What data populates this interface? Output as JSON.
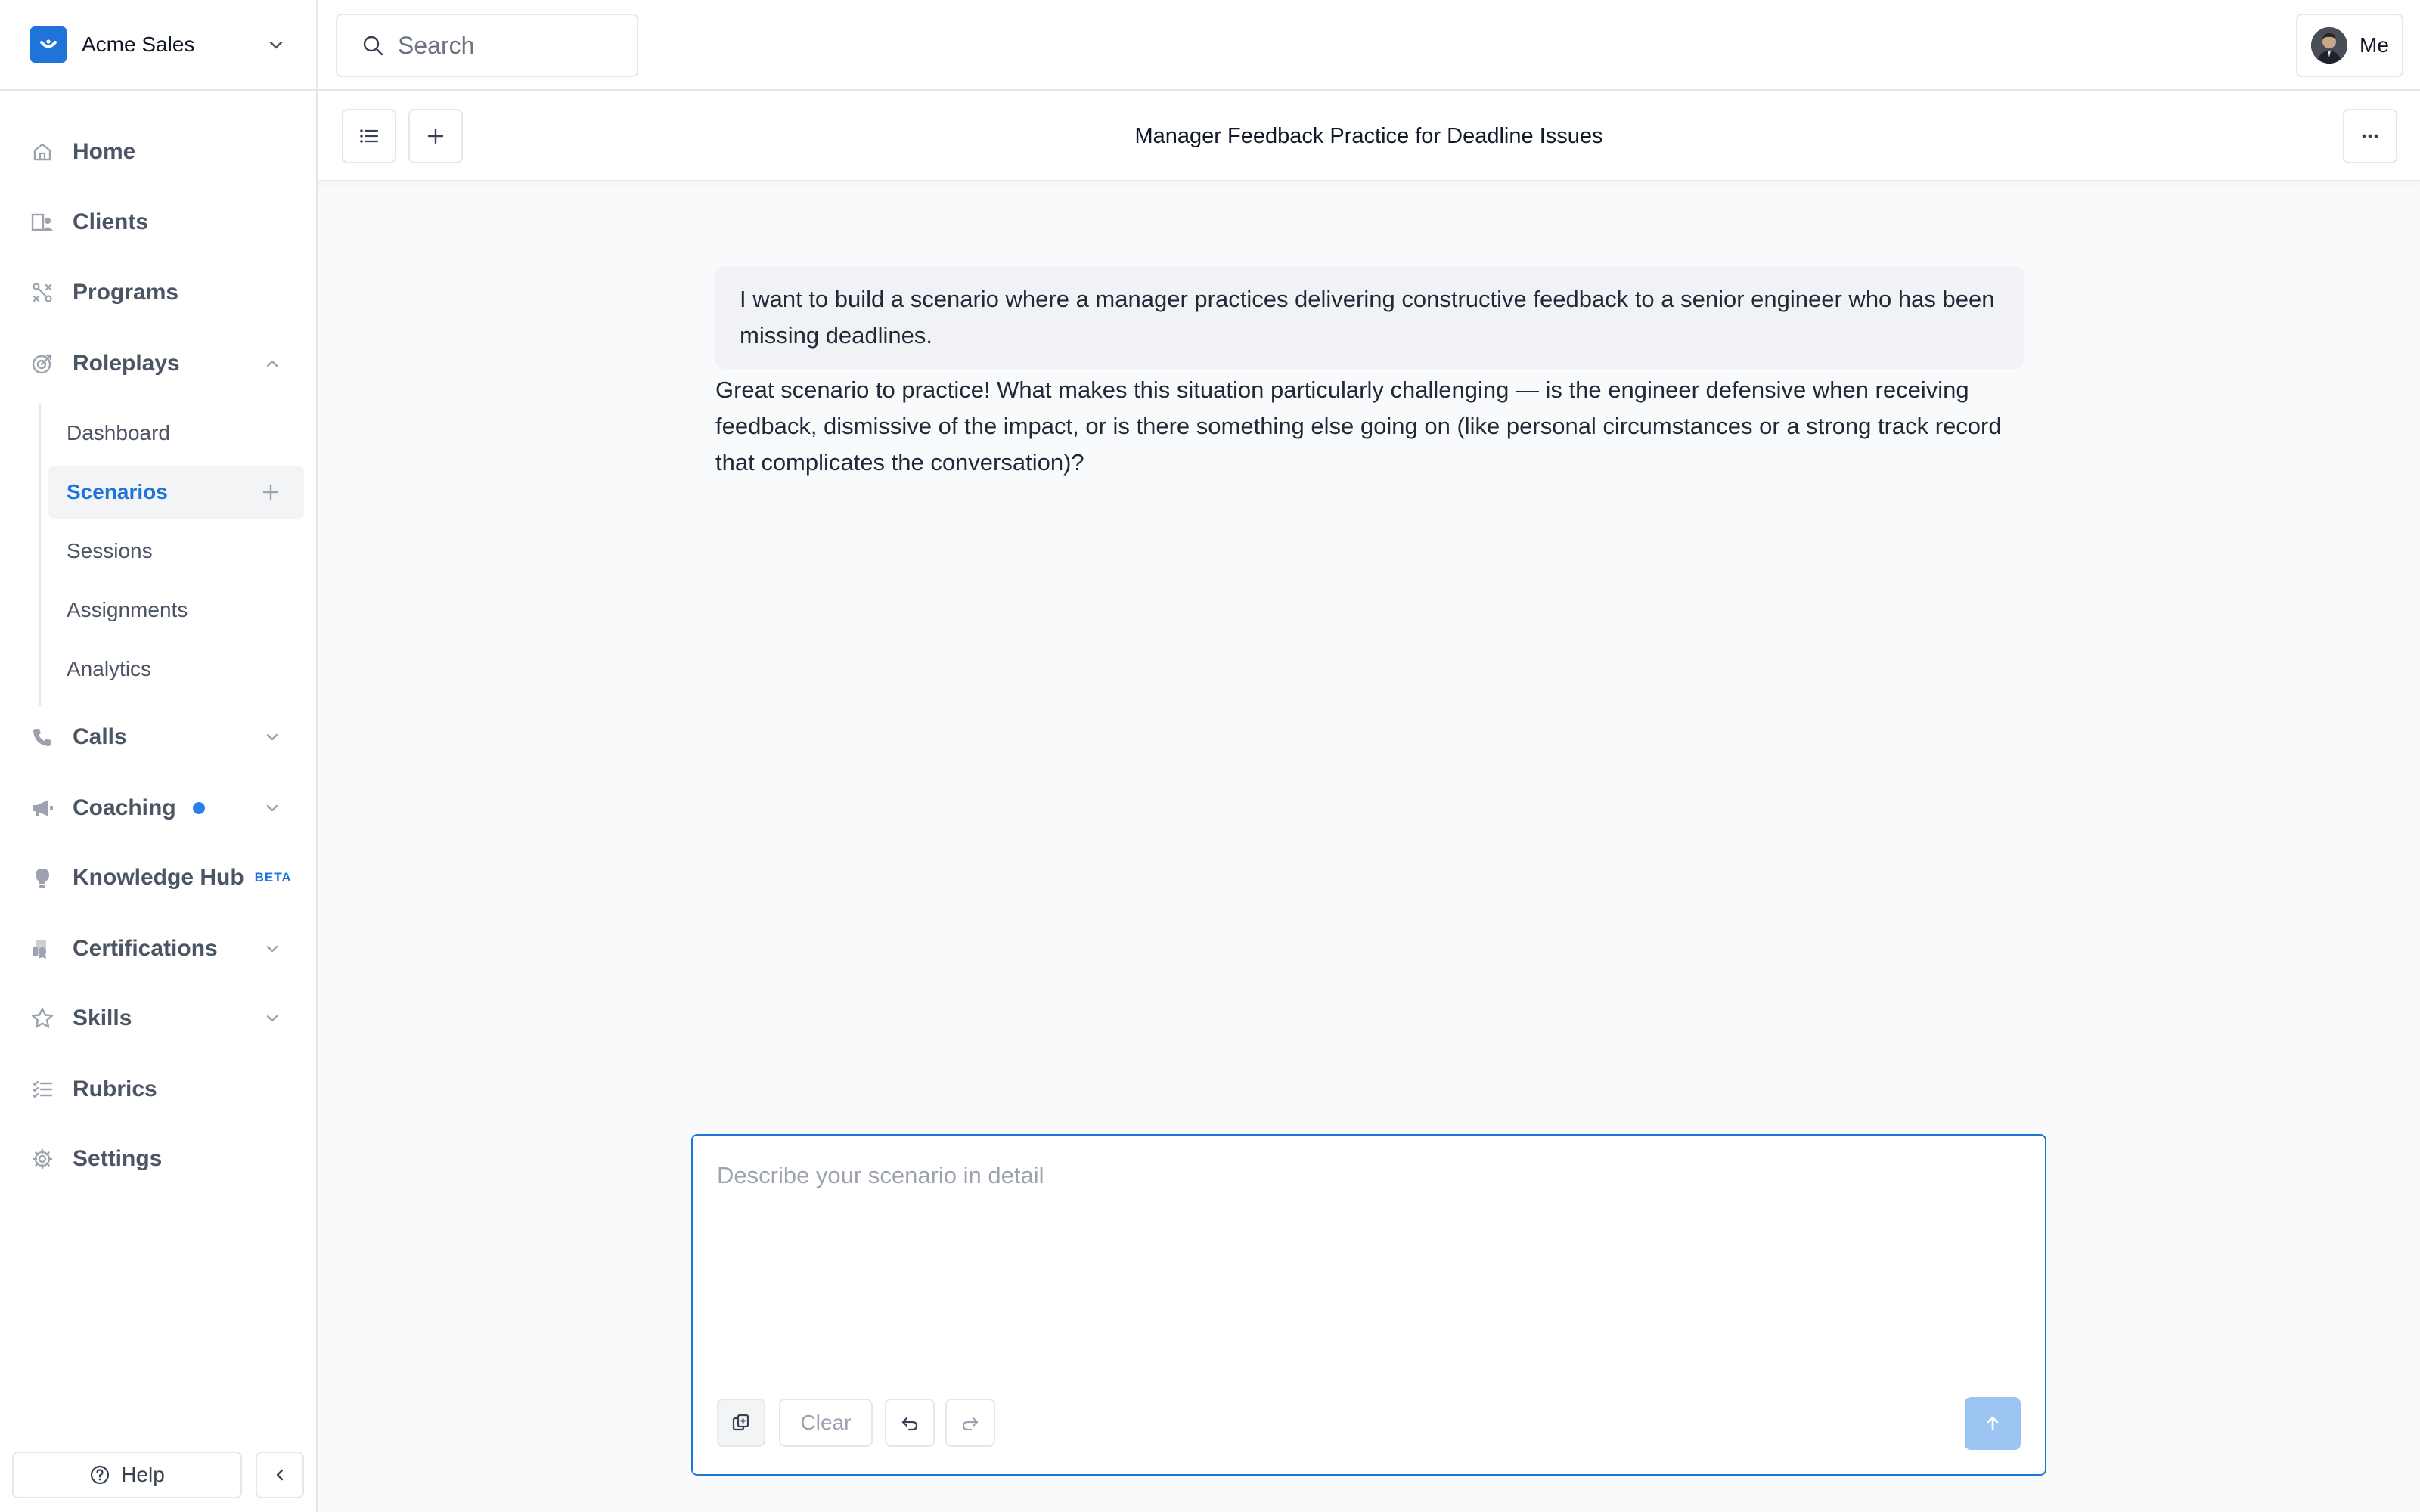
{
  "workspace": {
    "name": "Acme Sales"
  },
  "colors": {
    "accent": "#1f74d9",
    "send_disabled": "#9cc4f3",
    "notification_dot": "#2b7de9"
  },
  "search": {
    "placeholder": "Search"
  },
  "user_menu": {
    "label": "Me"
  },
  "nav": {
    "home": "Home",
    "clients": "Clients",
    "programs": "Programs",
    "roleplays": "Roleplays",
    "roleplays_sub": {
      "dashboard": "Dashboard",
      "scenarios": "Scenarios",
      "sessions": "Sessions",
      "assignments": "Assignments",
      "analytics": "Analytics"
    },
    "calls": "Calls",
    "coaching": "Coaching",
    "knowledge_hub": "Knowledge Hub",
    "knowledge_hub_badge": "BETA",
    "certifications": "Certifications",
    "skills": "Skills",
    "rubrics": "Rubrics",
    "settings": "Settings"
  },
  "footer": {
    "help": "Help"
  },
  "page": {
    "title": "Manager Feedback Practice for Deadline Issues"
  },
  "messages": [
    {
      "role": "user",
      "text": "I want to build a scenario where a manager practices delivering constructive feedback to a senior engineer who has been missing deadlines."
    },
    {
      "role": "assistant",
      "text": "Great scenario to practice! What makes this situation particularly challenging — is the engineer defensive when receiving feedback, dismissive of the impact, or is there something else going on (like personal circumstances or a strong track record that complicates the conversation)?"
    }
  ],
  "composer": {
    "placeholder": "Describe your scenario in detail",
    "clear_label": "Clear"
  }
}
